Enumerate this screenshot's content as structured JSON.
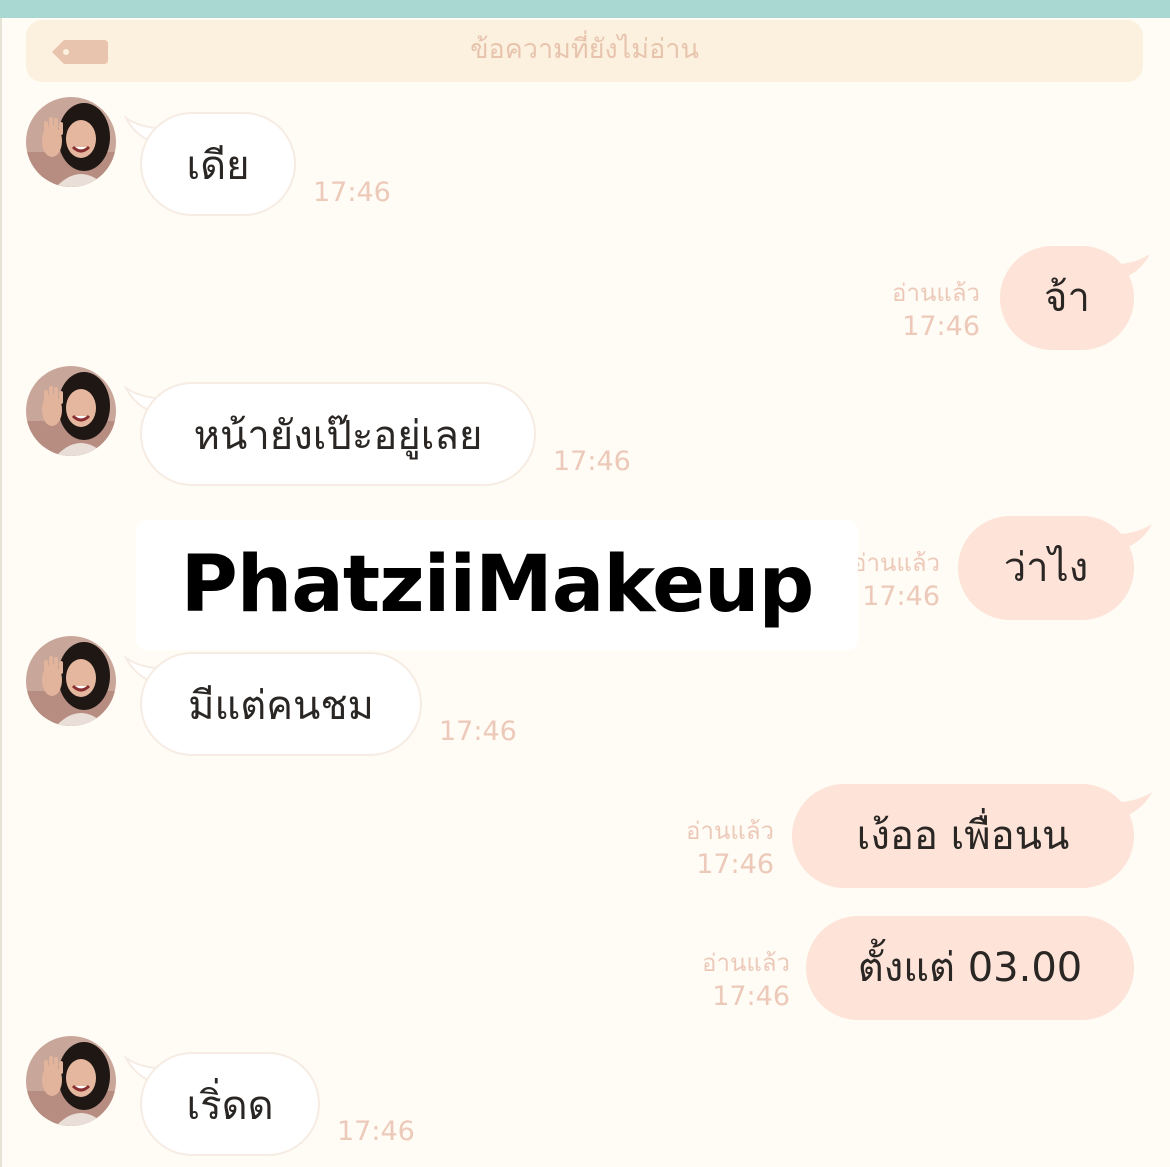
{
  "unread_banner": {
    "text": "ข้อความที่ยังไม่อ่าน",
    "icon": "tag-icon"
  },
  "messages": [
    {
      "direction": "incoming",
      "text": "เดีย",
      "time": "17:46"
    },
    {
      "direction": "outgoing",
      "text": "จ้า",
      "read": "อ่านแล้ว",
      "time": "17:46"
    },
    {
      "direction": "incoming",
      "text": "หน้ายังเป๊ะอยู่เลย",
      "time": "17:46"
    },
    {
      "direction": "outgoing",
      "text": "ว่าไง",
      "read": "อ่านแล้ว",
      "time": "17:46"
    },
    {
      "direction": "incoming",
      "text": "มีแต่คนชม",
      "time": "17:46"
    },
    {
      "direction": "outgoing",
      "text": "เง้ออ เพื่อนน",
      "read": "อ่านแล้ว",
      "time": "17:46"
    },
    {
      "direction": "outgoing",
      "text": "ตั้งแต่ 03.00",
      "read": "อ่านแล้ว",
      "time": "17:46"
    },
    {
      "direction": "incoming",
      "text": "เริ่ดด",
      "time": "17:46"
    }
  ],
  "watermark": {
    "text": "PhatziiMakeup"
  },
  "colors": {
    "background": "#fefcf5",
    "top_strip": "#a9d8d2",
    "incoming_bubble": "#ffffff",
    "outgoing_bubble": "#fde3d8",
    "meta_text": "#edc9b9"
  }
}
